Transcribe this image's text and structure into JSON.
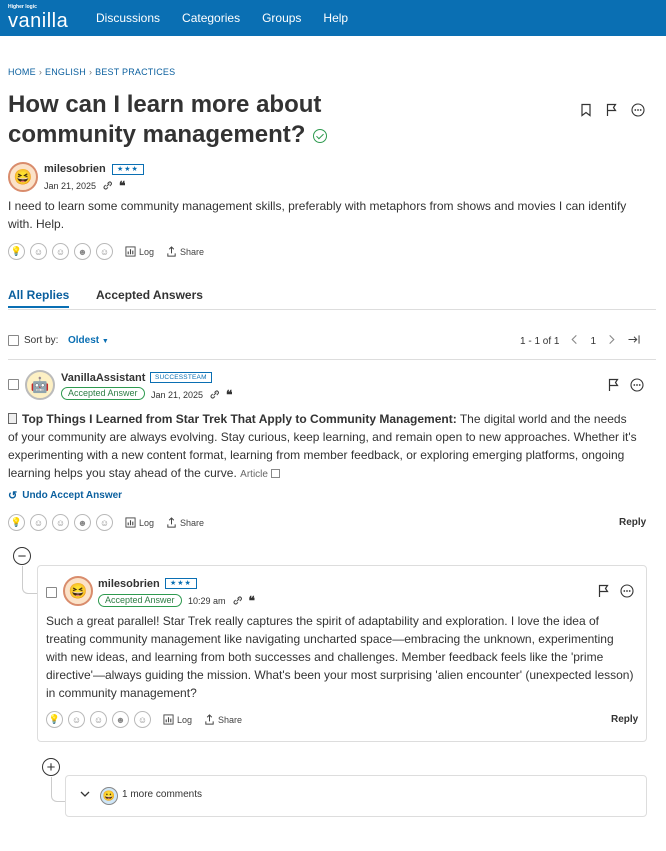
{
  "brand": {
    "tiny": "Higher logic",
    "name": "vanilla"
  },
  "nav": [
    "Discussions",
    "Categories",
    "Groups",
    "Help"
  ],
  "breadcrumb": [
    "HOME",
    "ENGLISH",
    "BEST PRACTICES"
  ],
  "post": {
    "title": "How can I learn more about community management?",
    "author": "milesobrien",
    "rank": "★★★",
    "date": "Jan 21, 2025",
    "body": "I need to learn some community management skills, preferably with metaphors from shows and movies I can identify with. Help.",
    "log_label": "Log",
    "share_label": "Share"
  },
  "tabs": [
    "All Replies",
    "Accepted Answers"
  ],
  "sort": {
    "label": "Sort by:",
    "value": "Oldest"
  },
  "pager": {
    "range": "1 - 1 of 1",
    "page": "1"
  },
  "reply": {
    "author": "VanillaAssistant",
    "rank": "SUCCESSTEAM",
    "accepted": "Accepted Answer",
    "date": "Jan 21, 2025",
    "article_title": "Top Things I Learned from Star Trek That Apply to Community Management:",
    "body": " The digital world and the needs of your community are always evolving. Stay curious, keep learning, and remain open to new approaches. Whether it's experimenting with a new content format, learning from member feedback, or exploring emerging platforms, ongoing learning helps you stay ahead of the curve.",
    "article_tag": "Article",
    "undo": "Undo Accept Answer",
    "log_label": "Log",
    "share_label": "Share",
    "reply_label": "Reply"
  },
  "comment": {
    "author": "milesobrien",
    "rank": "★★★",
    "accepted": "Accepted Answer",
    "time": "10:29 am",
    "body": "Such a great parallel! Star Trek really captures the spirit of adaptability and exploration. I love the idea of treating community management like navigating uncharted space—embracing the unknown, experimenting with new ideas, and learning from both successes and challenges. Member feedback feels like the 'prime directive'—always guiding the mission. What's been your most surprising 'alien encounter' (unexpected lesson) in community management?",
    "log_label": "Log",
    "share_label": "Share",
    "reply_label": "Reply"
  },
  "more_comments": "1 more comments",
  "colors": {
    "brand": "#0a6fb3",
    "accepted": "#2e9a4f"
  }
}
